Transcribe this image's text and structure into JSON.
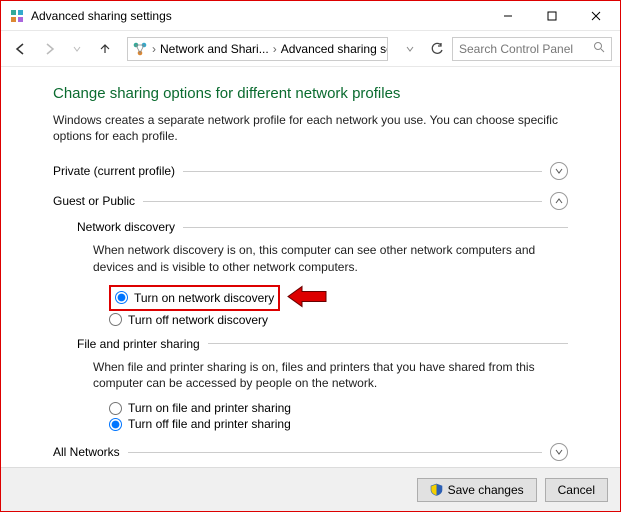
{
  "window": {
    "title": "Advanced sharing settings"
  },
  "nav": {
    "crumb1": "Network and Shari...",
    "crumb2": "Advanced sharing settings",
    "search_placeholder": "Search Control Panel"
  },
  "page": {
    "heading": "Change sharing options for different network profiles",
    "intro": "Windows creates a separate network profile for each network you use. You can choose specific options for each profile."
  },
  "profiles": {
    "private": {
      "label": "Private (current profile)"
    },
    "guest": {
      "label": "Guest or Public",
      "discovery": {
        "title": "Network discovery",
        "desc": "When network discovery is on, this computer can see other network computers and devices and is visible to other network computers.",
        "on": "Turn on network discovery",
        "off": "Turn off network discovery"
      },
      "fps": {
        "title": "File and printer sharing",
        "desc": "When file and printer sharing is on, files and printers that you have shared from this computer can be accessed by people on the network.",
        "on": "Turn on file and printer sharing",
        "off": "Turn off file and printer sharing"
      }
    },
    "all": {
      "label": "All Networks"
    }
  },
  "footer": {
    "save": "Save changes",
    "cancel": "Cancel"
  }
}
